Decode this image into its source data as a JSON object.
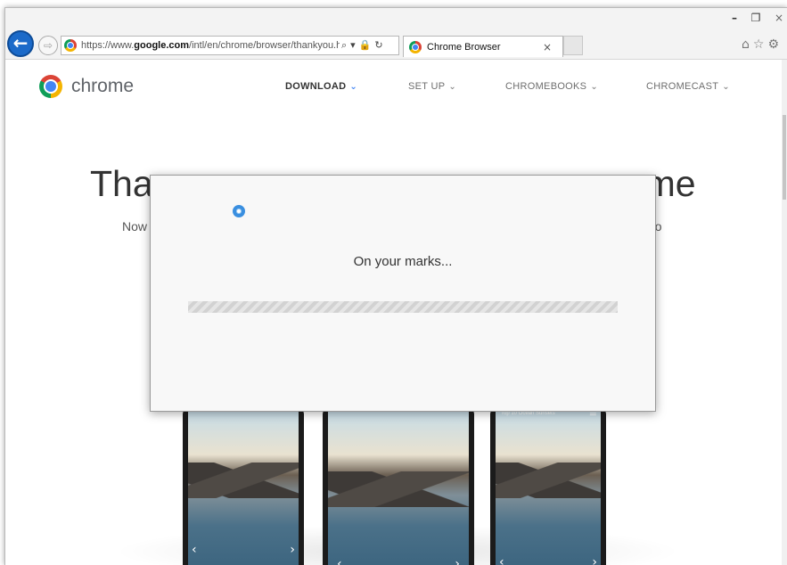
{
  "browser": {
    "url_prefix": "https://www.",
    "url_domain": "google.com",
    "url_path": "/intl/en/chrome/browser/thankyou.htr",
    "addr_icons": [
      "⌕",
      "▾",
      "🔒",
      "↻"
    ],
    "tab_title": "Chrome Browser",
    "tab_close": "×",
    "window_controls": {
      "minimize": "–",
      "maximize": "❐",
      "close": "×"
    },
    "back_glyph": "←",
    "forward_glyph": "⇨",
    "tool_icons": [
      "⌂",
      "☆",
      "⚙"
    ]
  },
  "site": {
    "brand": "chrome",
    "nav": [
      {
        "label": "DOWNLOAD",
        "active": true
      },
      {
        "label": "SET UP",
        "active": false
      },
      {
        "label": "CHROMEBOOKS",
        "active": false
      },
      {
        "label": "CHROMECAST",
        "active": false
      }
    ],
    "nav_chevron": "⌄",
    "headline_left": "Tha",
    "headline_right": "me",
    "sub_left": "Now",
    "sub_right": "oo",
    "phone_caption": "Top 10 Ocean Sunsets",
    "phone_arrows": {
      "left": "‹",
      "right": "›"
    },
    "phone_menu": "≡"
  },
  "dialog": {
    "title": "On your marks...",
    "progress": 0
  },
  "colors": {
    "accent": "#4285f4",
    "back_button": "#1b6ac9"
  }
}
